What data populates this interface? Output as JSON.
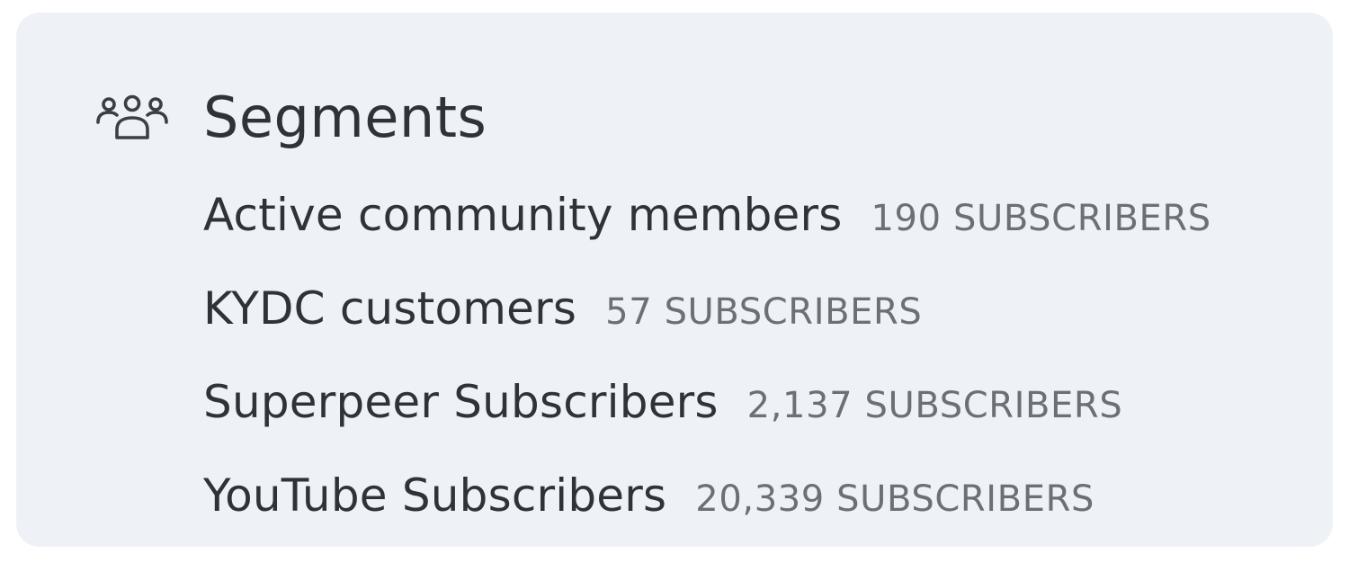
{
  "segments": {
    "title": "Segments",
    "icon": "users-group-icon",
    "colors": {
      "panel_background": "#eef2f7",
      "name_text": "#2e3338",
      "count_text": "#6b7076"
    },
    "items": [
      {
        "name": "Active community members",
        "count": "190 SUBSCRIBERS"
      },
      {
        "name": "KYDC customers",
        "count": "57 SUBSCRIBERS"
      },
      {
        "name": "Superpeer Subscribers",
        "count": "2,137 SUBSCRIBERS"
      },
      {
        "name": "YouTube Subscribers",
        "count": "20,339 SUBSCRIBERS"
      }
    ]
  }
}
